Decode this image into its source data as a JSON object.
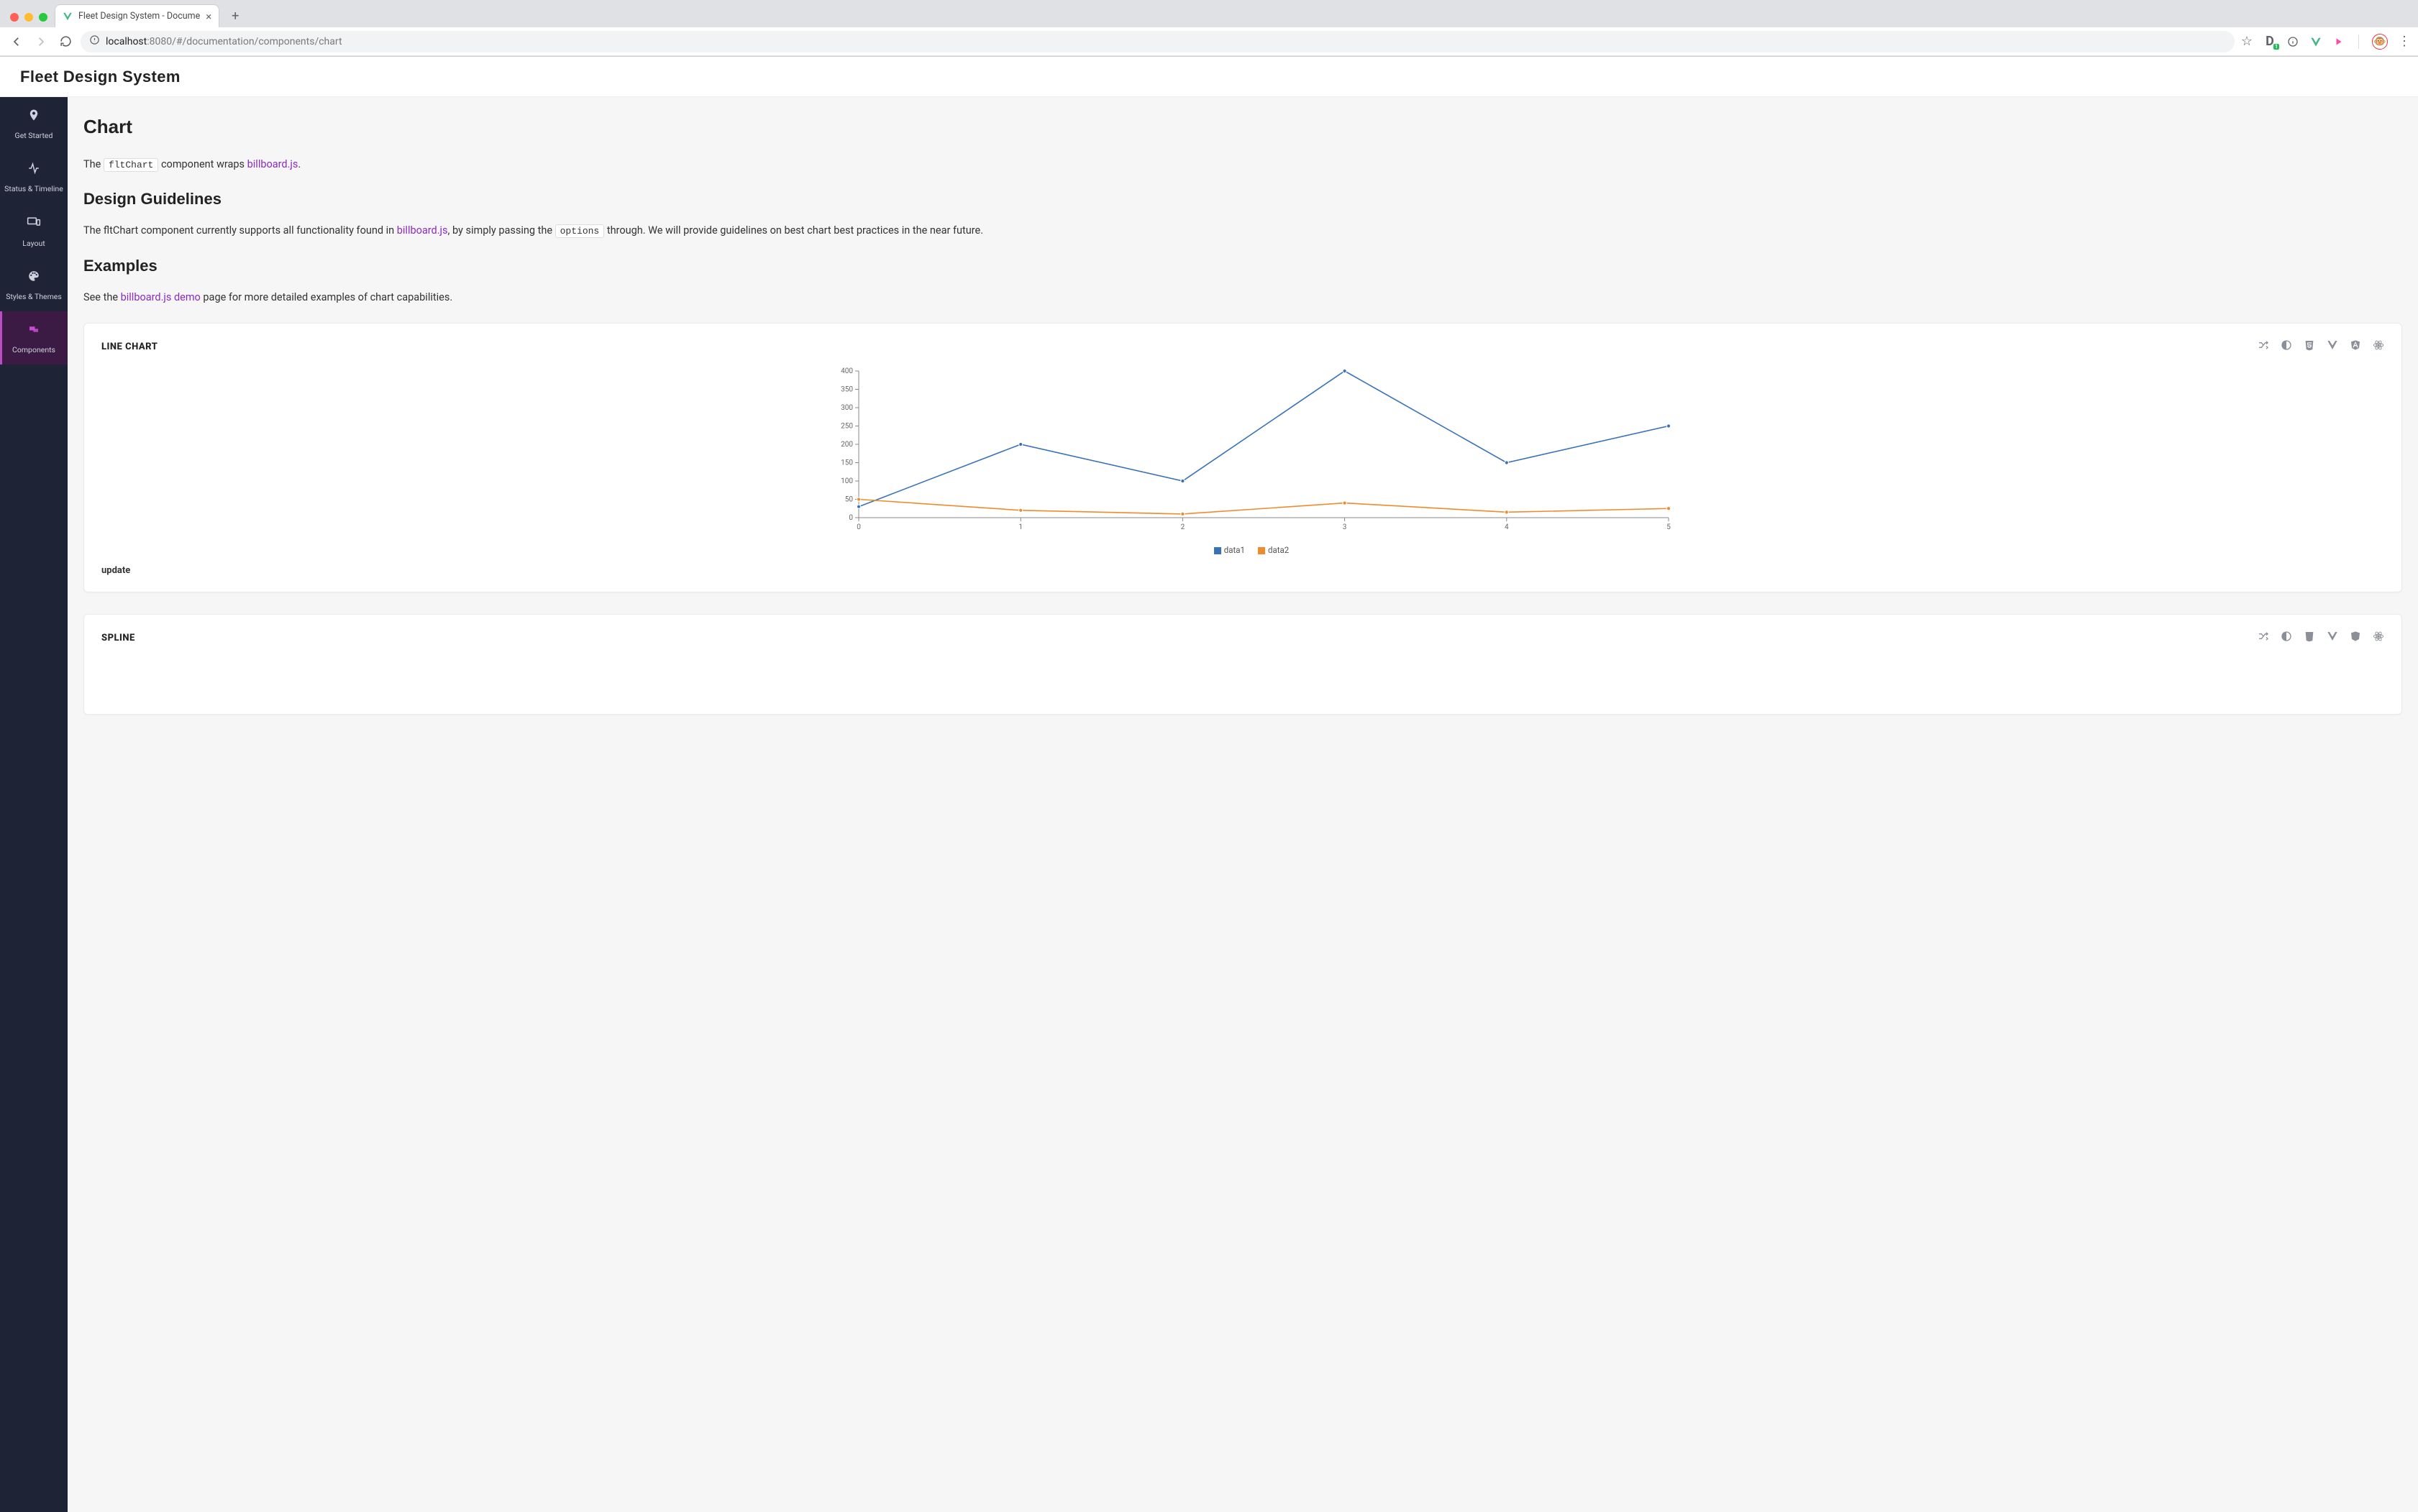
{
  "browser": {
    "tab_title": "Fleet Design System - Docume",
    "url_host": "localhost",
    "url_port": ":8080",
    "url_path": "/#/documentation/components/chart"
  },
  "header": {
    "brand": "Fleet Design System"
  },
  "sidebar": {
    "items": [
      {
        "label": "Get Started"
      },
      {
        "label": "Status & Timeline"
      },
      {
        "label": "Layout"
      },
      {
        "label": "Styles & Themes"
      },
      {
        "label": "Components"
      }
    ]
  },
  "page": {
    "title": "Chart",
    "intro_prefix": "The ",
    "intro_code": "fltChart",
    "intro_mid": " component wraps ",
    "intro_link": "billboard.js",
    "intro_suffix": ".",
    "guidelines_heading": "Design Guidelines",
    "guidelines_p1_a": "The fltChart component currently supports all functionality found in ",
    "guidelines_p1_link": "billboard.js",
    "guidelines_p1_b": ", by simply passing the ",
    "guidelines_p1_code": "options",
    "guidelines_p1_c": " through. We will provide guidelines on best chart best practices in the near future.",
    "examples_heading": "Examples",
    "examples_p_a": "See the ",
    "examples_link": "billboard.js demo",
    "examples_p_b": " page for more detailed examples of chart capabilities."
  },
  "cards": {
    "line": {
      "title": "LINE CHART",
      "footer": "update",
      "legend1": "data1",
      "legend2": "data2"
    },
    "spline": {
      "title": "SPLINE"
    }
  },
  "chart_data": {
    "type": "line",
    "title": "LINE CHART",
    "xlabel": "",
    "ylabel": "",
    "x": [
      0,
      1,
      2,
      3,
      4,
      5
    ],
    "y_ticks": [
      0,
      50,
      100,
      150,
      200,
      250,
      300,
      350,
      400
    ],
    "xlim": [
      0,
      5
    ],
    "ylim": [
      0,
      400
    ],
    "series": [
      {
        "name": "data1",
        "color": "#3972b8",
        "values": [
          30,
          200,
          100,
          400,
          150,
          250
        ]
      },
      {
        "name": "data2",
        "color": "#f08b2c",
        "values": [
          50,
          20,
          10,
          40,
          15,
          25
        ]
      }
    ],
    "legend_position": "bottom",
    "grid": false
  }
}
